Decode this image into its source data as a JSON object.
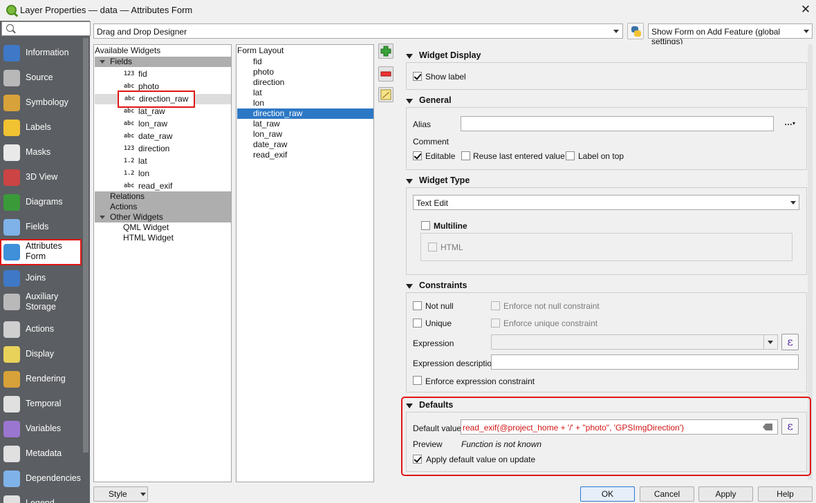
{
  "window": {
    "title": "Layer Properties — data — Attributes Form"
  },
  "nav": {
    "items": [
      {
        "label": "Information",
        "icon": "info-icon",
        "color": "#3f78c6"
      },
      {
        "label": "Source",
        "icon": "source-gears-icon",
        "color": "#b8b8b8"
      },
      {
        "label": "Symbology",
        "icon": "symbology-brush-icon",
        "color": "#d8a23a"
      },
      {
        "label": "Labels",
        "icon": "labels-abc-icon",
        "color": "#f1c232"
      },
      {
        "label": "Masks",
        "icon": "masks-abc-icon",
        "color": "#e9e9e9"
      },
      {
        "label": "3D View",
        "icon": "3d-view-cube-icon",
        "color": "#c44"
      },
      {
        "label": "Diagrams",
        "icon": "diagrams-icon",
        "color": "#3a9a3a"
      },
      {
        "label": "Fields",
        "icon": "fields-table-icon",
        "color": "#7fb2e8"
      },
      {
        "label": "Attributes Form",
        "icon": "attributes-form-icon",
        "color": "#3f8fd9",
        "active": true
      },
      {
        "label": "Joins",
        "icon": "joins-icon",
        "color": "#3f78c6"
      },
      {
        "label": "Auxiliary Storage",
        "icon": "auxiliary-storage-icon",
        "color": "#b9b9b9"
      },
      {
        "label": "Actions",
        "icon": "actions-gear-icon",
        "color": "#cfcfcf"
      },
      {
        "label": "Display",
        "icon": "display-bubble-icon",
        "color": "#e8d25a"
      },
      {
        "label": "Rendering",
        "icon": "rendering-brush-icon",
        "color": "#d8a23a"
      },
      {
        "label": "Temporal",
        "icon": "temporal-clock-icon",
        "color": "#e0e0e0"
      },
      {
        "label": "Variables",
        "icon": "variables-epsilon-icon",
        "color": "#9a76d0"
      },
      {
        "label": "Metadata",
        "icon": "metadata-icon",
        "color": "#e0e0e0"
      },
      {
        "label": "Dependencies",
        "icon": "dependencies-icon",
        "color": "#7fb2e8"
      },
      {
        "label": "Legend",
        "icon": "legend-icon",
        "color": "#e0e0e0"
      }
    ]
  },
  "toolbar": {
    "designer": "Drag and Drop Designer",
    "show_form": "Show Form on Add Feature (global settings)"
  },
  "available": {
    "header": "Available Widgets",
    "fields_label": "Fields",
    "fields": [
      {
        "type": "123",
        "name": "fid"
      },
      {
        "type": "abc",
        "name": "photo"
      },
      {
        "type": "abc",
        "name": "direction_raw"
      },
      {
        "type": "abc",
        "name": "lat_raw"
      },
      {
        "type": "abc",
        "name": "lon_raw"
      },
      {
        "type": "abc",
        "name": "date_raw"
      },
      {
        "type": "123",
        "name": "direction"
      },
      {
        "type": "1.2",
        "name": "lat"
      },
      {
        "type": "1.2",
        "name": "lon"
      },
      {
        "type": "abc",
        "name": "read_exif"
      }
    ],
    "relations_label": "Relations",
    "actions_label": "Actions",
    "other_label": "Other Widgets",
    "other": [
      "QML Widget",
      "HTML Widget"
    ]
  },
  "layout": {
    "header": "Form Layout",
    "items": [
      "fid",
      "photo",
      "direction",
      "lat",
      "lon",
      "direction_raw",
      "lat_raw",
      "lon_raw",
      "date_raw",
      "read_exif"
    ]
  },
  "widget_display": {
    "title": "Widget Display",
    "show_label": "Show label"
  },
  "general": {
    "title": "General",
    "alias_label": "Alias",
    "alias_value": "",
    "comment_label": "Comment",
    "editable": "Editable",
    "reuse": "Reuse last entered value",
    "label_on_top": "Label on top"
  },
  "widget_type": {
    "title": "Widget Type",
    "value": "Text Edit",
    "multiline": "Multiline",
    "html": "HTML"
  },
  "constraints": {
    "title": "Constraints",
    "not_null": "Not null",
    "enforce_not_null": "Enforce not null constraint",
    "unique": "Unique",
    "enforce_unique": "Enforce unique constraint",
    "expression_label": "Expression",
    "expression_desc_label": "Expression description",
    "enforce_expr": "Enforce expression constraint"
  },
  "defaults": {
    "title": "Defaults",
    "default_label": "Default value",
    "default_value": "read_exif(@project_home + '/' + \"photo\", 'GPSImgDirection')",
    "preview_label": "Preview",
    "preview_value": "Function is not known",
    "apply_on_update": "Apply default value on update"
  },
  "buttons": {
    "style": "Style",
    "ok": "OK",
    "cancel": "Cancel",
    "apply": "Apply",
    "help": "Help"
  },
  "colors": {
    "accent_red": "#e01515",
    "selection": "#2d78c5",
    "sidebar": "#5b5e62"
  }
}
